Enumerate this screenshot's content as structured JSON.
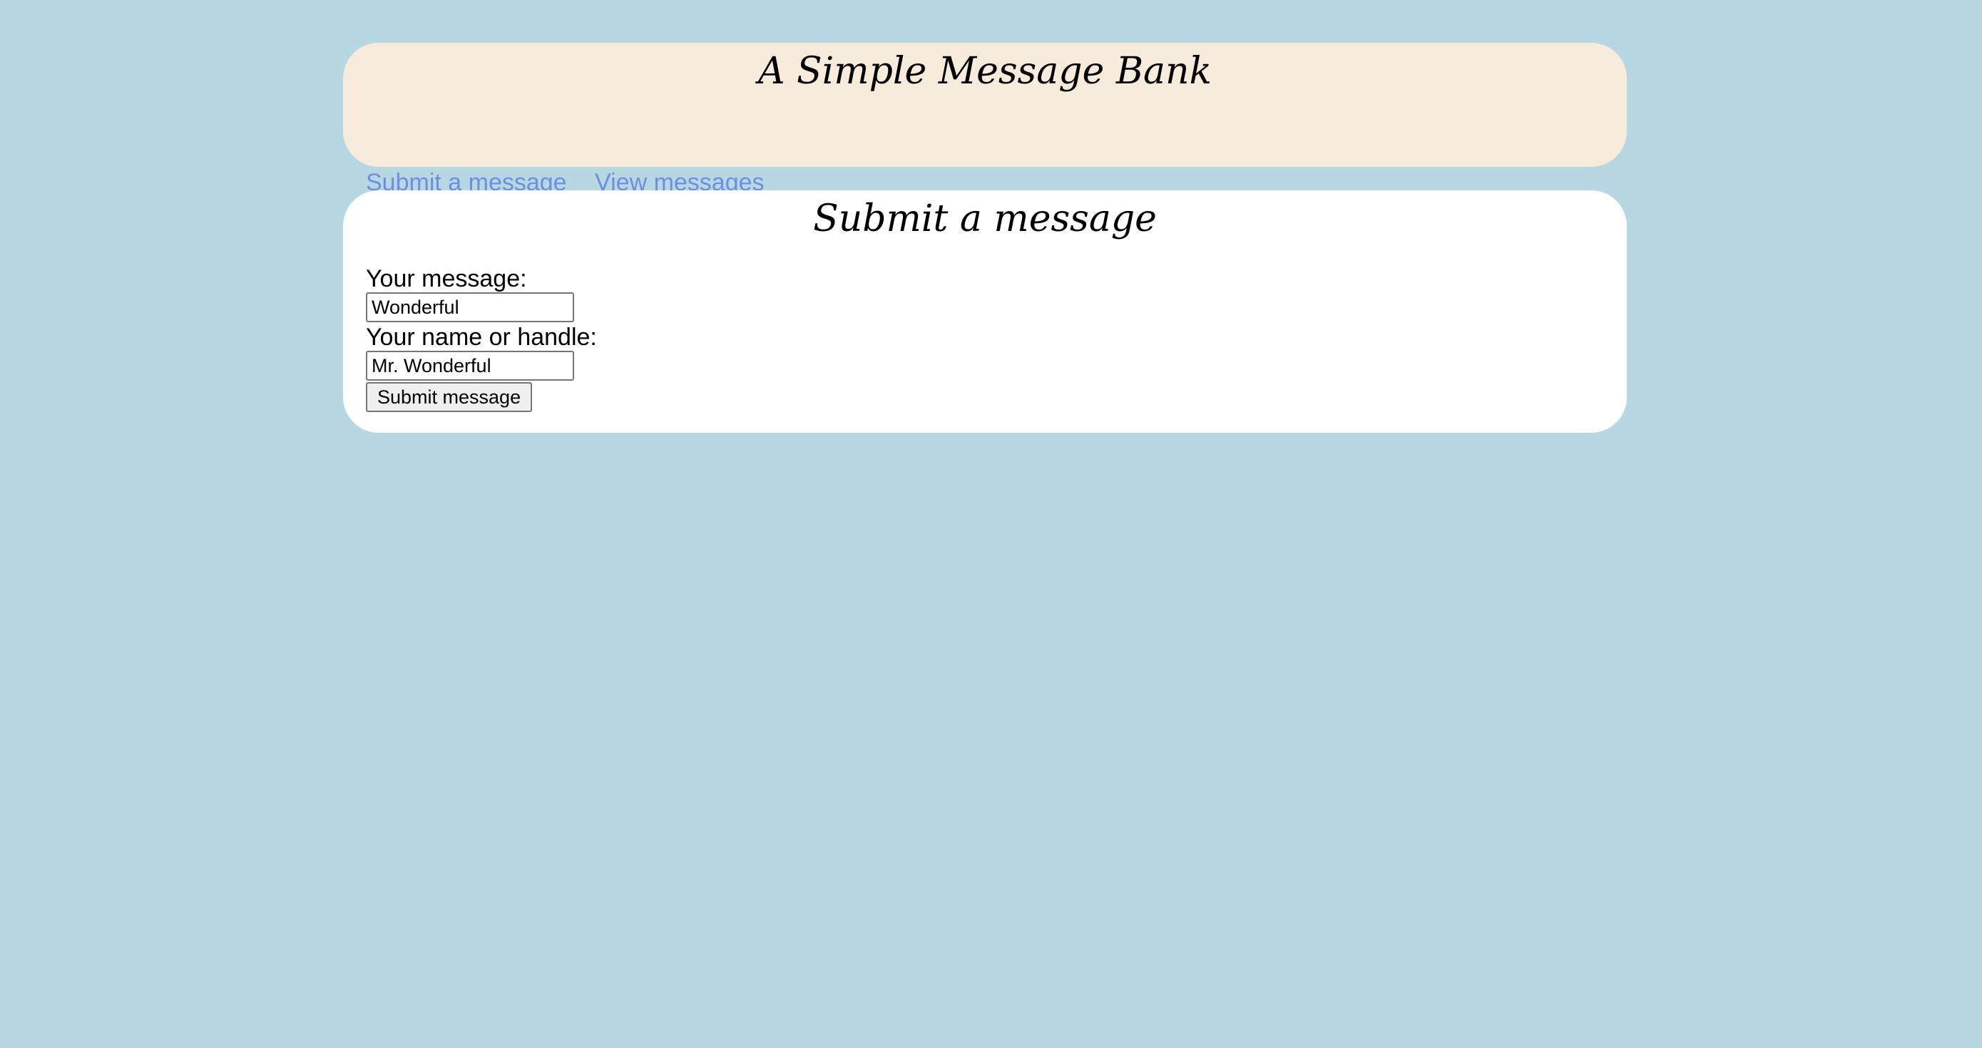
{
  "header": {
    "title": "A Simple Message Bank",
    "nav": [
      {
        "label": "Submit a message"
      },
      {
        "label": "View messages"
      }
    ]
  },
  "main": {
    "title": "Submit a message",
    "form": {
      "message_label": "Your message:",
      "message_value": "Wonderful",
      "name_label": "Your name or handle:",
      "name_value": "Mr. Wonderful",
      "submit_label": "Submit message"
    }
  },
  "colors": {
    "page_background": "#b7d8e3",
    "header_background": "#f7ebdb",
    "link": "#6d8fe2",
    "card_background": "#ffffff"
  }
}
